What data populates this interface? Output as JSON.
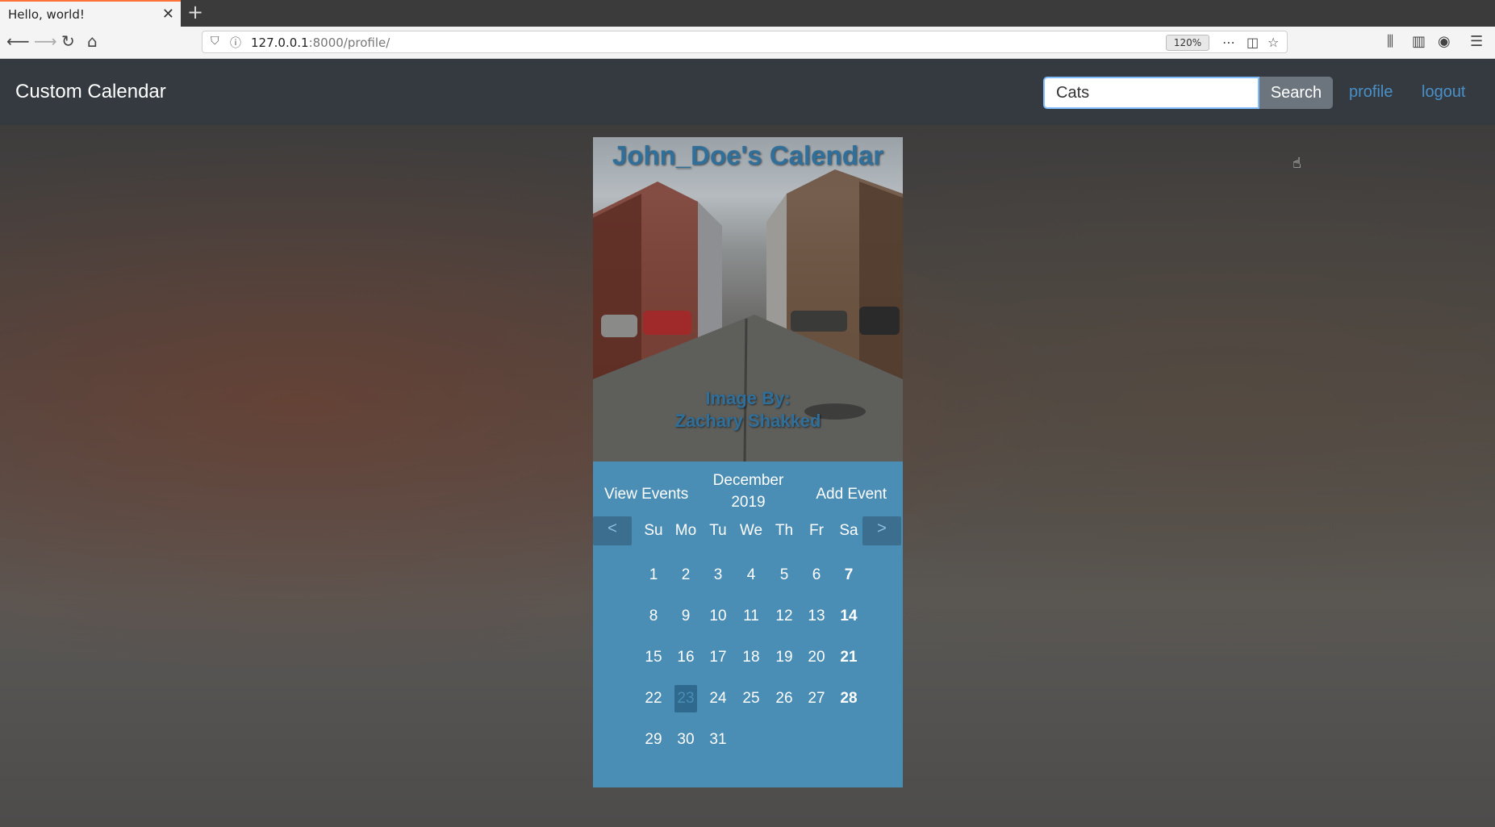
{
  "browser": {
    "tab_title": "Hello, world!",
    "url_host": "127.0.0.1",
    "url_path": ":8000/profile/",
    "zoom": "120%"
  },
  "site": {
    "brand": "Custom Calendar",
    "search_value": "Cats",
    "search_button": "Search",
    "links": [
      "profile",
      "logout"
    ]
  },
  "calendar": {
    "title": "John_Doe's Calendar",
    "credit_line1": "Image By:",
    "credit_line2": "Zachary Shakked",
    "view_events": "View Events",
    "add_event": "Add Event",
    "month": "December",
    "year": "2019",
    "prev": "<",
    "next": ">",
    "weekdays": [
      "Su",
      "Mo",
      "Tu",
      "We",
      "Th",
      "Fr",
      "Sa"
    ],
    "today": 23,
    "weeks": [
      [
        "1",
        "2",
        "3",
        "4",
        "5",
        "6",
        "7"
      ],
      [
        "8",
        "9",
        "10",
        "11",
        "12",
        "13",
        "14"
      ],
      [
        "15",
        "16",
        "17",
        "18",
        "19",
        "20",
        "21"
      ],
      [
        "22",
        "23",
        "24",
        "25",
        "26",
        "27",
        "28"
      ],
      [
        "29",
        "30",
        "31",
        "",
        "",
        "",
        ""
      ]
    ]
  },
  "icons": {
    "back": "arrow-left-icon",
    "forward": "arrow-right-icon",
    "reload": "reload-icon",
    "home": "home-icon"
  },
  "colors": {
    "navbar": "#343a40",
    "calendar_panel": "#4a8db5",
    "link": "#4a90c8",
    "title_text": "#2f6f9a"
  }
}
